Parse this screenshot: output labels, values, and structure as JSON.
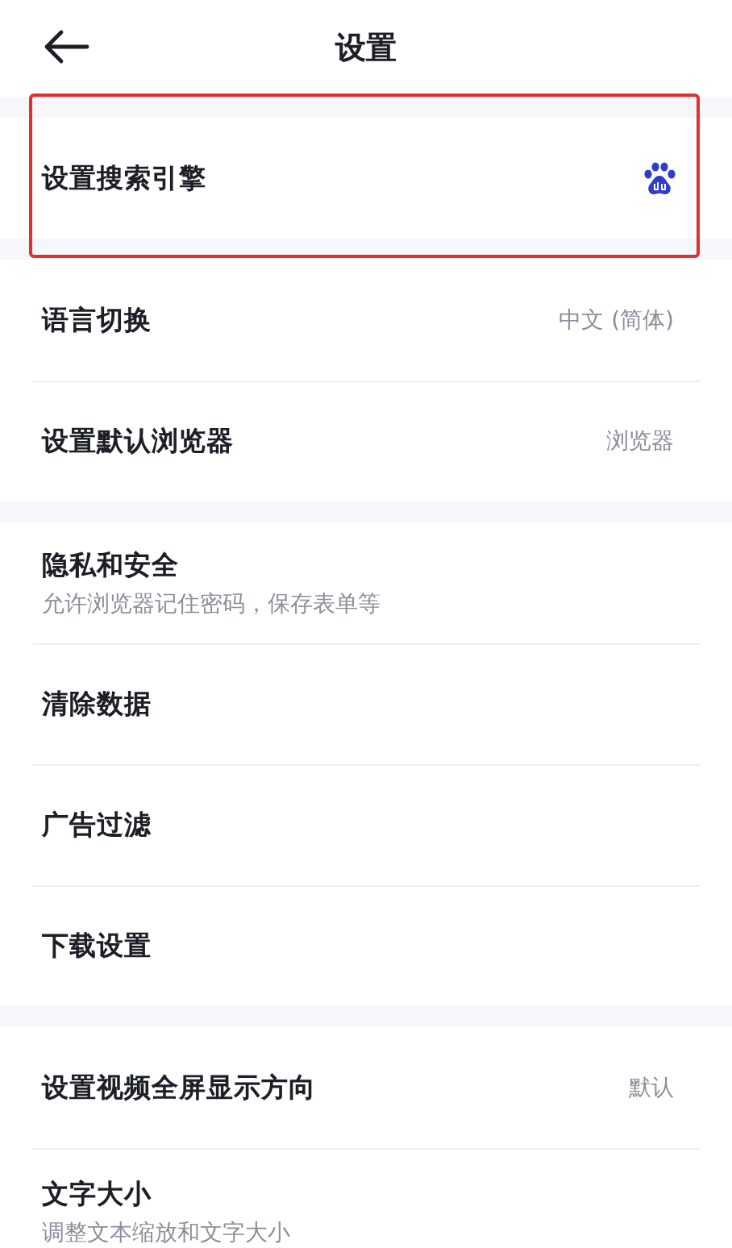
{
  "header": {
    "title": "设置"
  },
  "sections": [
    {
      "items": [
        {
          "title": "设置搜索引擎",
          "kind": "engine-icon",
          "highlighted": true
        }
      ]
    },
    {
      "items": [
        {
          "title": "语言切换",
          "kind": "value",
          "value": "中文 (简体)",
          "highlighted": false
        },
        {
          "title": "设置默认浏览器",
          "kind": "value",
          "value": "浏览器",
          "highlighted": false
        }
      ]
    },
    {
      "items": [
        {
          "title": "隐私和安全",
          "kind": "plain",
          "subtitle": "允许浏览器记住密码，保存表单等",
          "highlighted": false
        },
        {
          "title": "清除数据",
          "kind": "plain",
          "highlighted": false
        },
        {
          "title": "广告过滤",
          "kind": "plain",
          "highlighted": false
        },
        {
          "title": "下载设置",
          "kind": "plain",
          "highlighted": false
        }
      ]
    },
    {
      "items": [
        {
          "title": "设置视频全屏显示方向",
          "kind": "value",
          "value": "默认",
          "highlighted": false
        },
        {
          "title": "文字大小",
          "kind": "plain",
          "subtitle": "调整文本缩放和文字大小",
          "highlighted": false
        }
      ]
    }
  ]
}
